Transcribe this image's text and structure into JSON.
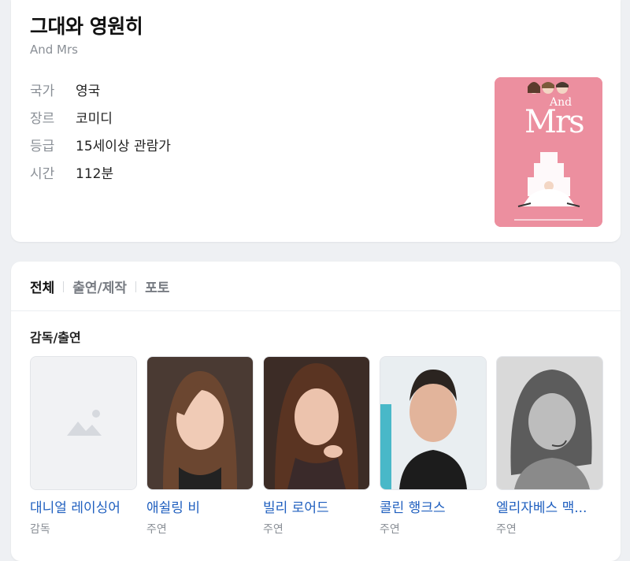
{
  "movie": {
    "title": "그대와 영원히",
    "original_title": "And Mrs",
    "info": [
      {
        "key": "국가",
        "value": "영국"
      },
      {
        "key": "장르",
        "value": "코미디"
      },
      {
        "key": "등급",
        "value": "15세이상 관람가"
      },
      {
        "key": "시간",
        "value": "112분"
      }
    ],
    "poster": {
      "line1": "And",
      "line2": "Mrs",
      "background": "#ec8f9f"
    }
  },
  "tabs": [
    {
      "label": "전체",
      "active": true
    },
    {
      "label": "출연/제작",
      "active": false
    },
    {
      "label": "포토",
      "active": false
    }
  ],
  "section_title": "감독/출연",
  "people": [
    {
      "name": "대니얼 레이싱어",
      "role": "감독",
      "photo": "placeholder-image-icon"
    },
    {
      "name": "애쉴링 비",
      "role": "주연",
      "photo": "portrait-photo"
    },
    {
      "name": "빌리 로어드",
      "role": "주연",
      "photo": "portrait-photo"
    },
    {
      "name": "콜린 행크스",
      "role": "주연",
      "photo": "portrait-photo"
    },
    {
      "name": "엘리자베스 맥...",
      "role": "주연",
      "photo": "portrait-photo"
    }
  ],
  "colors": {
    "link": "#1f5fbf",
    "muted": "#8a8f96",
    "poster_pink": "#ec8f9f"
  }
}
